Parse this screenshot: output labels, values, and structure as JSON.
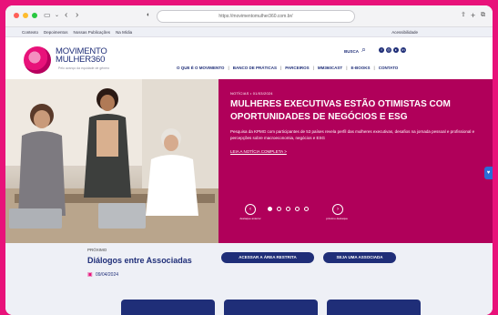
{
  "browser": {
    "url": "https://movimentomulher360.com.br/",
    "back": "‹",
    "forward": "›"
  },
  "topbar": {
    "links": [
      "Contexto",
      "Depoimentos",
      "Nossas Publicações",
      "Na Mídia"
    ],
    "accessibility": "Acessibilidade"
  },
  "header": {
    "logo_line1": "MOVIMENTO",
    "logo_line2": "MULHER360",
    "logo_tagline": "Pelo avanço da equidade de gênero",
    "search_label": "BUSCA",
    "social_icons": [
      "facebook-icon",
      "instagram-icon",
      "youtube-icon",
      "linkedin-icon"
    ]
  },
  "nav": {
    "items": [
      "O QUE É O MOVIMENTO",
      "BANCO DE PRÁTICAS",
      "PARCEIROS",
      "MM360CAST",
      "E-BOOKS",
      "CONTATO"
    ]
  },
  "hero": {
    "tag": "NOTÍCIAS • 01/03/2024",
    "title": "MULHERES EXECUTIVAS ESTÃO OTIMISTAS COM OPORTUNIDADES DE NEGÓCIOS E ESG",
    "body": "Pesquisa da KPMG com participantes de 53 países revela perfil das mulheres executivas, desafios na jornada pessoal e profissional e percepções sobre macroeconomia, negócios e ESG",
    "link": "LEIA A NOTÍCIA COMPLETA >",
    "prev_label": "destaque anterior",
    "next_label": "próximo destaque",
    "slides": 5,
    "active_slide": 1
  },
  "event": {
    "kicker": "PRÓXIMO",
    "title": "Diálogos entre Associadas",
    "date": "09/04/2024"
  },
  "buttons": {
    "restricted": "ACESSAR A ÁREA RESTRITA",
    "join": "SEJA UMA ASSOCIADA"
  },
  "colors": {
    "background": "#e8127a",
    "brand_magenta": "#b0005a",
    "brand_navy": "#1f2e78"
  }
}
